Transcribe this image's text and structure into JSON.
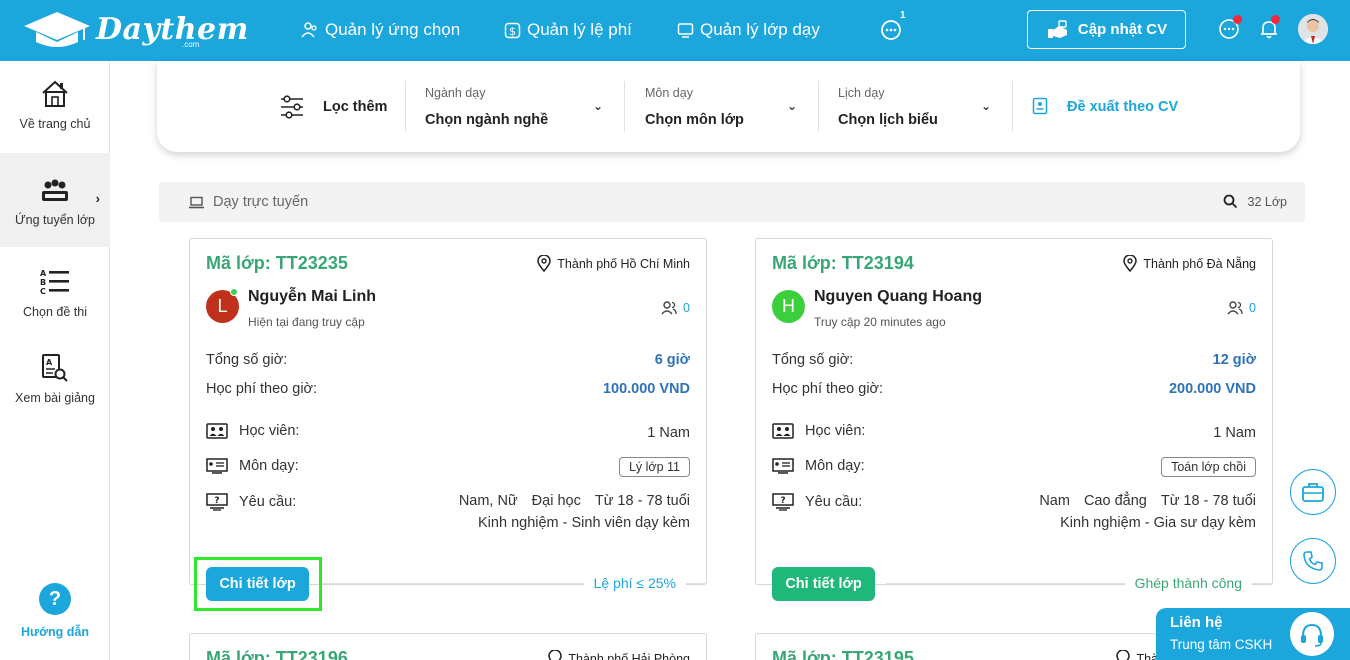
{
  "brand": {
    "name": "Daythem",
    "suffix": ".com"
  },
  "nav": {
    "items": [
      {
        "label": "Quản lý ứng chọn"
      },
      {
        "label": "Quản lý lệ phí"
      },
      {
        "label": "Quản lý lớp dạy"
      }
    ],
    "chat_badge": "1",
    "cv_button": "Cập nhật CV"
  },
  "sidebar": {
    "items": [
      {
        "label": "Về trang chủ"
      },
      {
        "label": "Ứng tuyển lớp"
      },
      {
        "label": "Chọn đề thi"
      },
      {
        "label": "Xem bài giảng"
      }
    ],
    "help_label": "Hướng dẫn",
    "help_glyph": "?"
  },
  "filter": {
    "title": "Lọc thêm",
    "fields": [
      {
        "label": "Ngành dạy",
        "value": "Chọn ngành nghề"
      },
      {
        "label": "Môn dạy",
        "value": "Chọn môn lớp"
      },
      {
        "label": "Lịch dạy",
        "value": "Chọn lịch biểu"
      }
    ],
    "suggest": "Đề xuất theo CV"
  },
  "subheader": {
    "mode": "Dạy trực tuyến",
    "count": "32 Lớp"
  },
  "labels": {
    "total_hours": "Tổng số giờ:",
    "fee_per_hour": "Học phí theo giờ:",
    "students": "Học viên:",
    "subject": "Môn dạy:",
    "requirement": "Yêu cầu:",
    "detail_button": "Chi tiết lớp"
  },
  "cards": [
    {
      "code": "Mã lớp: TT23235",
      "city": "Thành phố Hồ Chí Minh",
      "avatar_letter": "L",
      "avatar_color": "#c0311c",
      "user": "Nguyễn Mai Linh",
      "status": "Hiện tại đang truy cập",
      "applicants": "0",
      "hours": "6 giờ",
      "fee": "100.000 VND",
      "students": "1 Nam",
      "subject": "Lý lớp 11",
      "req_gender": "Nam, Nữ",
      "req_level": "Đại học",
      "req_age": "Từ 18 - 78 tuổi",
      "req_exp": "Kinh nghiệm - Sinh viên dạy kèm",
      "button_color": "#1ba6dc",
      "footnote": "Lệ phí ≤ 25%",
      "footnote_color": "#1ba6dc"
    },
    {
      "code": "Mã lớp: TT23194",
      "city": "Thành phố Đà Nẵng",
      "avatar_letter": "H",
      "avatar_color": "#3ccf3c",
      "user": "Nguyen Quang Hoang",
      "status": "Truy cập 20 minutes ago",
      "applicants": "0",
      "hours": "12 giờ",
      "fee": "200.000 VND",
      "students": "1 Nam",
      "subject": "Toán lớp chồi",
      "req_gender": "Nam",
      "req_level": "Cao đẳng",
      "req_age": "Từ 18 - 78 tuổi",
      "req_exp": "Kinh nghiệm - Gia sư dạy kèm",
      "button_color": "#1fb87a",
      "footnote": "Ghép thành công",
      "footnote_color": "#3aa676"
    }
  ],
  "partial_cards": [
    {
      "code": "Mã lớp: TT23196",
      "city": "Thành phố Hải Phòng"
    },
    {
      "code": "Mã lớp: TT23195",
      "city": "Thà"
    }
  ],
  "contact": {
    "title": "Liên hệ",
    "subtitle": "Trung tâm CSKH"
  },
  "colors": {
    "brand": "#1ba6dc",
    "green": "#3aa676",
    "highlight": "#2ee82e"
  }
}
